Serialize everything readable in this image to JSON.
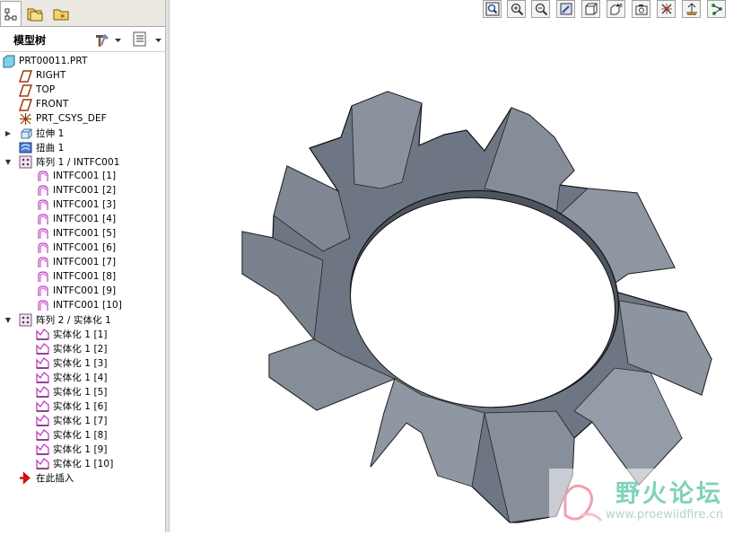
{
  "tree_header": {
    "title": "模型树"
  },
  "tree": {
    "root": "PRT00011.PRT",
    "datums": [
      "RIGHT",
      "TOP",
      "FRONT",
      "PRT_CSYS_DEF"
    ],
    "features": [
      "拉伸 1",
      "扭曲 1"
    ],
    "pattern1": {
      "label": "阵列 1 / INTFC001",
      "items": [
        "INTFC001 [1]",
        "INTFC001 [2]",
        "INTFC001 [3]",
        "INTFC001 [4]",
        "INTFC001 [5]",
        "INTFC001 [6]",
        "INTFC001 [7]",
        "INTFC001 [8]",
        "INTFC001 [9]",
        "INTFC001 [10]"
      ]
    },
    "pattern2": {
      "label": "阵列 2 / 实体化 1",
      "items": [
        "实体化 1 [1]",
        "实体化 1 [2]",
        "实体化 1 [3]",
        "实体化 1 [4]",
        "实体化 1 [5]",
        "实体化 1 [6]",
        "实体化 1 [7]",
        "实体化 1 [8]",
        "实体化 1 [9]",
        "实体化 1 [10]"
      ]
    },
    "insert_here": "在此插入"
  },
  "toolbar_icons": [
    "refit-icon",
    "zoom-in-icon",
    "zoom-out-icon",
    "repaint-icon",
    "view-orient-icon",
    "saved-views-icon",
    "layers-icon",
    "spin-center-icon",
    "datum-display-icon",
    "annotation-icon"
  ],
  "watermark": {
    "title": "野火论坛",
    "url": "www.proewildfire.cn"
  },
  "colors": {
    "model_fill": "#6e7684",
    "model_edge": "#111111",
    "tree_pink": "#c040c0",
    "insert_arrow": "#cc1111"
  }
}
